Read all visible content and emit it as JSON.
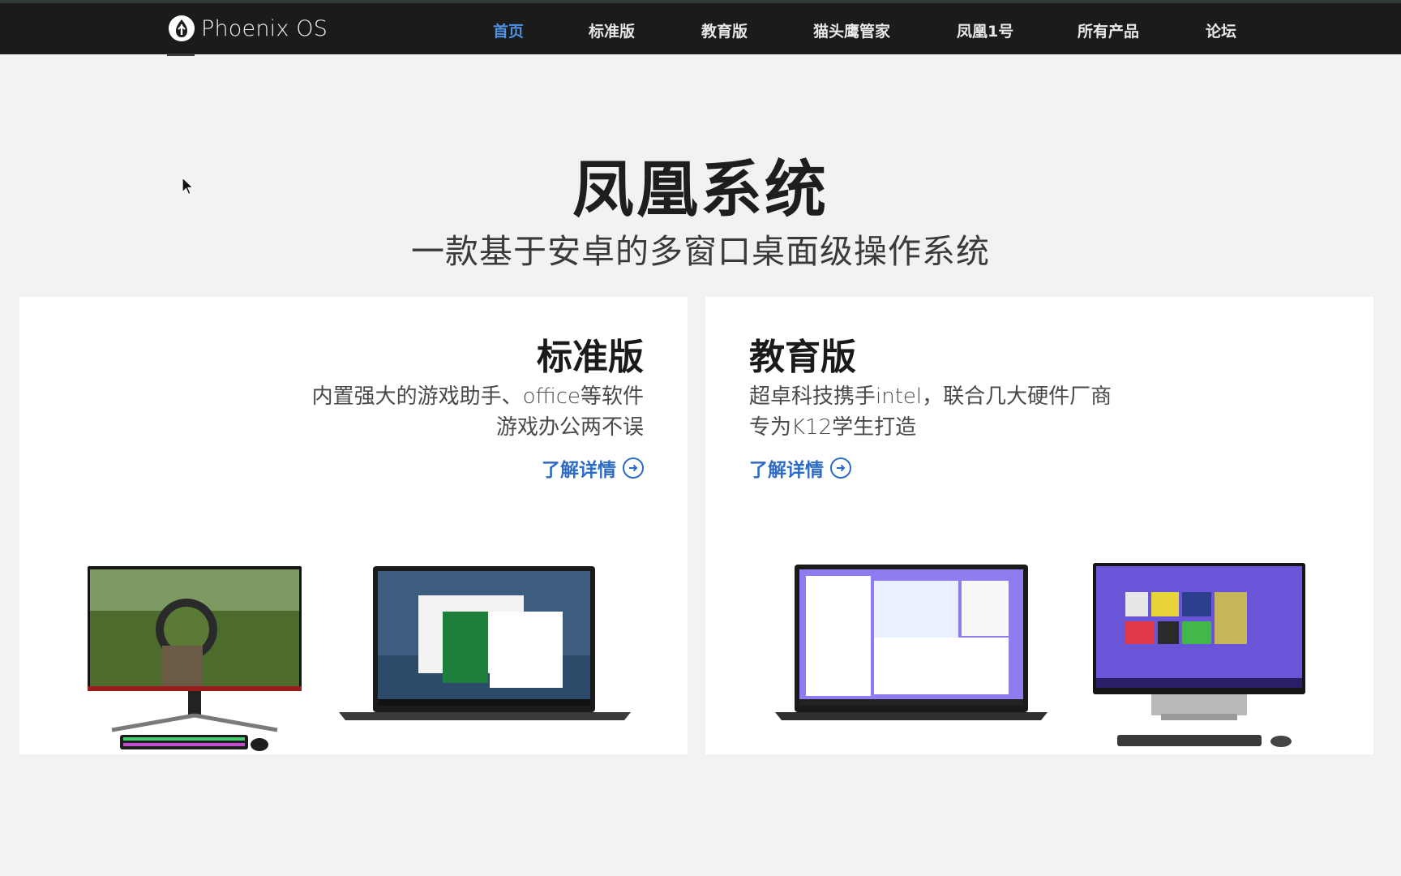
{
  "nav": {
    "logo_text": "Phoenix OS",
    "items": [
      {
        "label": "首页",
        "active": true
      },
      {
        "label": "标准版",
        "active": false
      },
      {
        "label": "教育版",
        "active": false
      },
      {
        "label": "猫头鹰管家",
        "active": false
      },
      {
        "label": "凤凰1号",
        "active": false
      },
      {
        "label": "所有产品",
        "active": false
      },
      {
        "label": "论坛",
        "active": false
      }
    ]
  },
  "hero": {
    "title": "凤凰系统",
    "subtitle": "一款基于安卓的多窗口桌面级操作系统"
  },
  "cards": {
    "standard": {
      "title": "标准版",
      "desc_line1": "内置强大的游戏助手、office等软件",
      "desc_line2": "游戏办公两不误",
      "more": "了解详情"
    },
    "education": {
      "title": "教育版",
      "desc_line1": "超卓科技携手intel，联合几大硬件厂商",
      "desc_line2": "专为K12学生打造",
      "more": "了解详情"
    }
  },
  "colors": {
    "nav_bg": "#1b1b1b",
    "nav_active": "#4f93e6",
    "link": "#2e6cc4",
    "page_bg": "#f2f2f2"
  }
}
